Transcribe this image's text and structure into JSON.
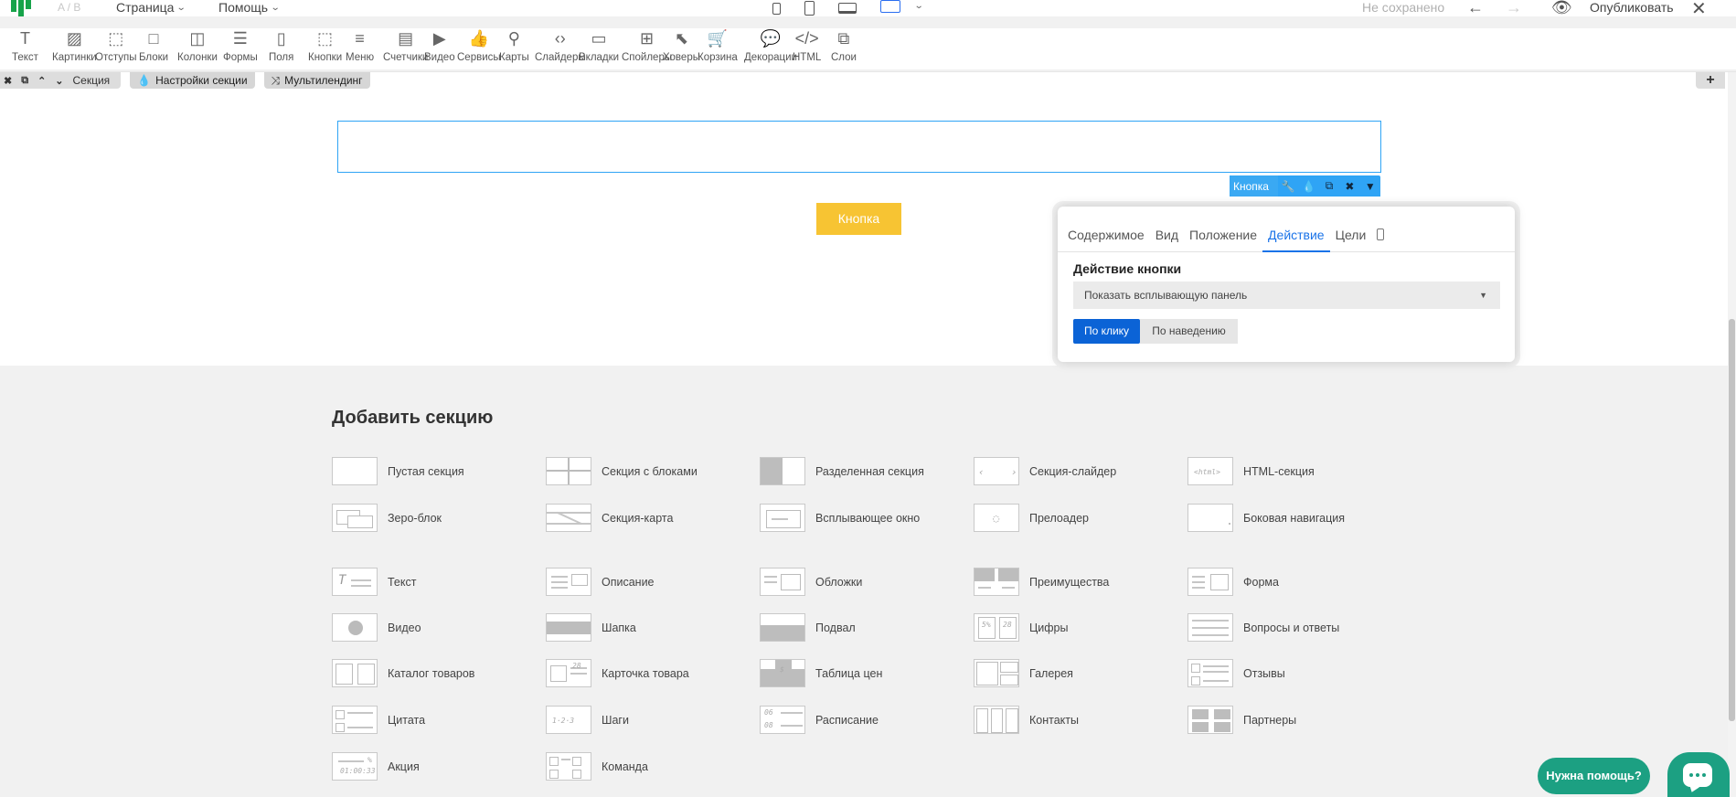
{
  "topbar": {
    "ab": "A / B",
    "menu_page": "Страница",
    "menu_help": "Помощь",
    "not_saved": "Не сохранено",
    "publish": "Опубликовать"
  },
  "toolbar": [
    {
      "name": "tool-text",
      "label": "Текст",
      "icon": "T"
    },
    {
      "name": "tool-images",
      "label": "Картинки",
      "icon": "▨"
    },
    {
      "name": "tool-spacing",
      "label": "Отступы",
      "icon": "⬚"
    },
    {
      "name": "tool-blocks",
      "label": "Блоки",
      "icon": "□"
    },
    {
      "name": "tool-columns",
      "label": "Колонки",
      "icon": "◫"
    },
    {
      "name": "tool-forms",
      "label": "Формы",
      "icon": "☰"
    },
    {
      "name": "tool-fields",
      "label": "Поля",
      "icon": "▯"
    },
    {
      "name": "tool-buttons",
      "label": "Кнопки",
      "icon": "⬚"
    },
    {
      "name": "tool-menu",
      "label": "Меню",
      "icon": "≡"
    },
    {
      "name": "tool-counters",
      "label": "Счетчики",
      "icon": "▤"
    },
    {
      "name": "tool-video",
      "label": "Видео",
      "icon": "▶"
    },
    {
      "name": "tool-services",
      "label": "Сервисы",
      "icon": "👍"
    },
    {
      "name": "tool-maps",
      "label": "Карты",
      "icon": "⚲"
    },
    {
      "name": "tool-sliders",
      "label": "Слайдеры",
      "icon": "‹›"
    },
    {
      "name": "tool-tabs",
      "label": "Вкладки",
      "icon": "▭"
    },
    {
      "name": "tool-spoilers",
      "label": "Спойлеры",
      "icon": "⊞"
    },
    {
      "name": "tool-hovers",
      "label": "Ховеры",
      "icon": "⬉"
    },
    {
      "name": "tool-cart",
      "label": "Корзина",
      "icon": "🛒"
    },
    {
      "name": "tool-decorations",
      "label": "Декорации",
      "icon": "💬"
    },
    {
      "name": "tool-html",
      "label": "HTML",
      "icon": "</>"
    },
    {
      "name": "tool-layers",
      "label": "Слои",
      "icon": "⧉"
    }
  ],
  "section_bar": {
    "section_label": "Секция",
    "settings_label": "Настройки секции",
    "multilanding_label": "Мультилендинг"
  },
  "button_block": {
    "button_text": "Кнопка",
    "tag_label": "Кнопка"
  },
  "panel": {
    "tabs": [
      "Содержимое",
      "Вид",
      "Положение",
      "Действие",
      "Цели"
    ],
    "active_tab": "Действие",
    "title": "Действие кнопки",
    "action_value": "Показать всплывающую панель",
    "trigger_click": "По клику",
    "trigger_hover": "По наведению"
  },
  "add_section": {
    "title": "Добавить секцию",
    "items": [
      {
        "label": "Пустая секция",
        "thumb": "empty"
      },
      {
        "label": "Секция с блоками",
        "thumb": "blocks"
      },
      {
        "label": "Разделенная секция",
        "thumb": "split"
      },
      {
        "label": "Секция-слайдер",
        "thumb": "slider"
      },
      {
        "label": "HTML-секция",
        "thumb": "html"
      },
      {
        "label": "Зеро-блок",
        "thumb": "zero"
      },
      {
        "label": "Секция-карта",
        "thumb": "map"
      },
      {
        "label": "Всплывающее окно",
        "thumb": "popup"
      },
      {
        "label": "Прелоадер",
        "thumb": "preloader"
      },
      {
        "label": "Боковая навигация",
        "thumb": "sidenav"
      },
      {
        "label": "Текст",
        "thumb": "text"
      },
      {
        "label": "Описание",
        "thumb": "description"
      },
      {
        "label": "Обложки",
        "thumb": "covers"
      },
      {
        "label": "Преимущества",
        "thumb": "advantages"
      },
      {
        "label": "Форма",
        "thumb": "form"
      },
      {
        "label": "Видео",
        "thumb": "video"
      },
      {
        "label": "Шапка",
        "thumb": "header"
      },
      {
        "label": "Подвал",
        "thumb": "footer"
      },
      {
        "label": "Цифры",
        "thumb": "numbers"
      },
      {
        "label": "Вопросы и ответы",
        "thumb": "faq"
      },
      {
        "label": "Каталог товаров",
        "thumb": "catalog"
      },
      {
        "label": "Карточка товара",
        "thumb": "product"
      },
      {
        "label": "Таблица цен",
        "thumb": "prices"
      },
      {
        "label": "Галерея",
        "thumb": "gallery"
      },
      {
        "label": "Отзывы",
        "thumb": "reviews"
      },
      {
        "label": "Цитата",
        "thumb": "quote"
      },
      {
        "label": "Шаги",
        "thumb": "steps"
      },
      {
        "label": "Расписание",
        "thumb": "schedule"
      },
      {
        "label": "Контакты",
        "thumb": "contacts"
      },
      {
        "label": "Партнеры",
        "thumb": "partners"
      },
      {
        "label": "Акция",
        "thumb": "promo"
      },
      {
        "label": "Команда",
        "thumb": "team"
      }
    ],
    "thumb_texts": {
      "html": "<html>",
      "numbers_a": "5%",
      "numbers_b": "28",
      "schedule_a": "06",
      "schedule_b": "08",
      "steps": "1·2·3",
      "promo_time": "01:00:33",
      "promo_pct": "%",
      "prices_sym": "$"
    }
  },
  "help": {
    "label": "Нужна помощь?"
  },
  "colors": {
    "accent": "#1a73e8",
    "brand_green": "#17a34a",
    "selection_blue": "#2fa4f5",
    "button_yellow": "#f7c433",
    "help_green": "#1ca082"
  }
}
